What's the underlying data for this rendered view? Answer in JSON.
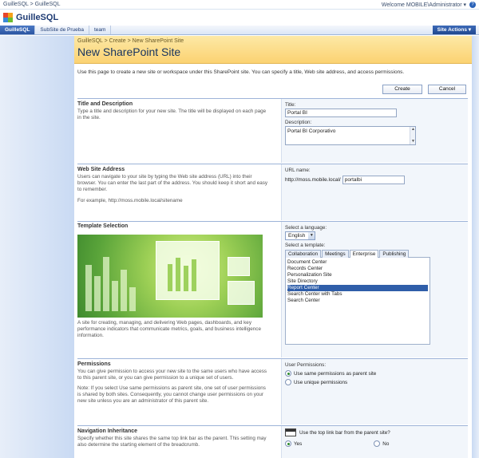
{
  "topbar": {
    "breadcrumb": "GuilleSQL > GuilleSQL",
    "welcome": "Welcome MOBILE\\Administrator ▾",
    "help_icon": "help-icon"
  },
  "brand": {
    "title": "GuilleSQL"
  },
  "nav": {
    "tabs": [
      {
        "label": "GuilleSQL"
      },
      {
        "label": "SubSite de Prueba"
      },
      {
        "label": "team"
      }
    ],
    "site_actions": "Site Actions ▾"
  },
  "page": {
    "breadcrumb": "GuilleSQL > Create > New SharePoint Site",
    "title": "New SharePoint Site",
    "intro": "Use this page to create a new site or workspace under this SharePoint site. You can specify a title, Web site address, and access permissions.",
    "create_label": "Create",
    "cancel_label": "Cancel"
  },
  "sections": {
    "title_desc": {
      "heading": "Title and Description",
      "desc": "Type a title and description for your new site. The title will be displayed on each page in the site.",
      "title_label": "Title:",
      "title_value": "Portal BI",
      "description_label": "Description:",
      "description_value": "Portal BI Corporativo"
    },
    "web_address": {
      "heading": "Web Site Address",
      "desc": "Users can navigate to your site by typing the Web site address (URL) into their browser. You can enter the last part of the address. You should keep it short and easy to remember.",
      "example": "For example, http://moss.mobile.local/sitename",
      "url_label": "URL name:",
      "url_prefix": "http://moss.mobile.local/",
      "url_value": "portalbi"
    },
    "template": {
      "heading": "Template Selection",
      "language_label": "Select a language:",
      "language_value": "English",
      "template_label": "Select a template:",
      "tabs": [
        "Collaboration",
        "Meetings",
        "Enterprise",
        "Publishing"
      ],
      "items": [
        "Document Center",
        "Records Center",
        "Personalization Site",
        "Site Directory",
        "Report Center",
        "Search Center with Tabs",
        "Search Center"
      ],
      "selected_item": "Report Center",
      "caption": "A site for creating, managing, and delivering Web pages, dashboards, and key performance indicators that communicate metrics, goals, and business intelligence information."
    },
    "permissions": {
      "heading": "Permissions",
      "desc": "You can give permission to access your new site to the same users who have access to this parent site, or you can give permission to a unique set of users.",
      "note": "Note: If you select Use same permissions as parent site, one set of user permissions is shared by both sites. Consequently, you cannot change user permissions on your new site unless you are an administrator of this parent site.",
      "label": "User Permissions:",
      "option_same": "Use same permissions as parent site",
      "option_unique": "Use unique permissions"
    },
    "navigation": {
      "heading": "Navigation Inheritance",
      "desc": "Specify whether this site shares the same top link bar as the parent. This setting may also determine the starting element of the breadcrumb.",
      "question": "Use the top link bar from the parent site?",
      "yes": "Yes",
      "no": "No"
    }
  },
  "colors": {
    "accent": "#2f5ea9",
    "header_gold": "#fbd272",
    "nav_blue": "#2a55a1"
  }
}
